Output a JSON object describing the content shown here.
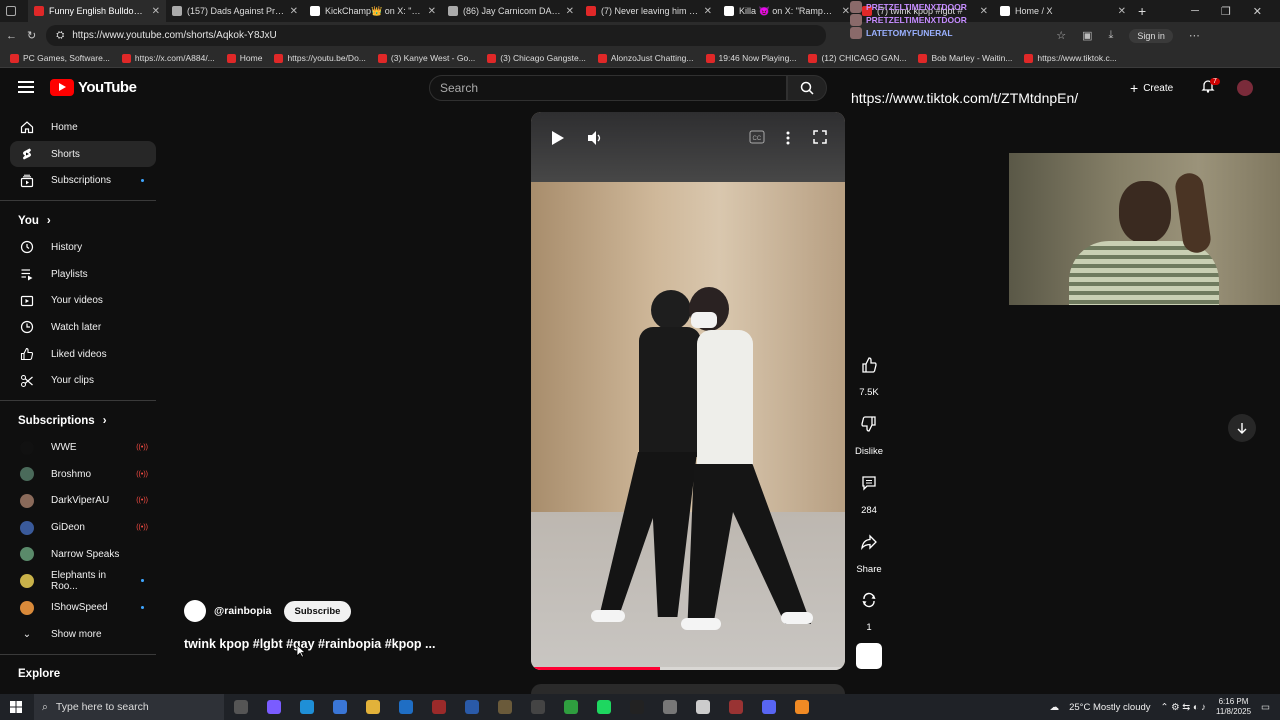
{
  "tabs": [
    {
      "title": "Funny English Bulldogs at H",
      "color": "#e02828",
      "active": true
    },
    {
      "title": "(157) Dads Against Predato",
      "color": "#aaaaaa",
      "active": false
    },
    {
      "title": "KickChamp👑 on X: \"Adin I",
      "color": "#ffffff",
      "active": false
    },
    {
      "title": "(86) Jay Carnicom DAP Con",
      "color": "#aaaaaa",
      "active": false
    },
    {
      "title": "(7) Never leaving him agai",
      "color": "#e02828",
      "active": false
    },
    {
      "title": "Killa 😈 on X: \"Rampage Jc",
      "color": "#ffffff",
      "active": false
    },
    {
      "title": "(7) twink kpop #lgbt #",
      "color": "#e02828",
      "active": false
    },
    {
      "title": "Home / X",
      "color": "#ffffff",
      "active": false
    }
  ],
  "address": {
    "url": "https://www.youtube.com/shorts/Aqkok-Y8JxU",
    "signin": "Sign in"
  },
  "bookmarks": [
    "PC Games, Software...",
    "https://x.com/A884/...",
    "Home",
    "https://youtu.be/Do...",
    "(3) Kanye West - Go...",
    "(3) Chicago Gangste...",
    "AlonzoJust Chatting...",
    "19:46 Now Playing...",
    "(12) CHICAGO GAN...",
    "Bob Marley - Waitin...",
    "https://www.tiktok.c..."
  ],
  "header": {
    "logo": "YouTube",
    "search_placeholder": "Search",
    "create": "Create",
    "notif_count": "7"
  },
  "sidebar": {
    "main": [
      {
        "label": "Home",
        "icon": "home-icon"
      },
      {
        "label": "Shorts",
        "icon": "shorts-icon",
        "active": true
      },
      {
        "label": "Subscriptions",
        "icon": "subscriptions-icon",
        "dot": true
      }
    ],
    "you_heading": "You",
    "you": [
      {
        "label": "History",
        "icon": "history-icon"
      },
      {
        "label": "Playlists",
        "icon": "playlists-icon"
      },
      {
        "label": "Your videos",
        "icon": "your-videos-icon"
      },
      {
        "label": "Watch later",
        "icon": "watch-later-icon"
      },
      {
        "label": "Liked videos",
        "icon": "liked-videos-icon"
      },
      {
        "label": "Your clips",
        "icon": "clips-icon"
      }
    ],
    "subs_heading": "Subscriptions",
    "subs": [
      {
        "label": "WWE",
        "color": "#111111",
        "status": "live"
      },
      {
        "label": "Broshmo",
        "color": "#4a6a5a",
        "status": "live"
      },
      {
        "label": "DarkViperAU",
        "color": "#8a6a5a",
        "status": "live"
      },
      {
        "label": "GiDeon",
        "color": "#3a5a9a",
        "status": "live"
      },
      {
        "label": "Narrow Speaks",
        "color": "#5a8a6a",
        "status": ""
      },
      {
        "label": "Elephants in Roo...",
        "color": "#c9b24a",
        "status": "dot"
      },
      {
        "label": "IShowSpeed",
        "color": "#d98a3a",
        "status": "dot"
      }
    ],
    "show_more": "Show more",
    "explore": "Explore"
  },
  "short": {
    "channel": "@rainbopia",
    "subscribe": "Subscribe",
    "title": "twink kpop #lgbt #gay #rainbopia #kpop ...",
    "progress": 0.41,
    "likes": "7.5K",
    "dislike": "Dislike",
    "comments": "284",
    "share": "Share",
    "remix": "1"
  },
  "stream": {
    "chat": [
      {
        "user": "PRETZELTIMENXTDOOR",
        "color": "#c58cff"
      },
      {
        "user": "PRETZELTIMENXTDOOR",
        "color": "#c58cff"
      },
      {
        "user": "LATETOMYFUNERAL",
        "color": "#9ab0ff"
      }
    ],
    "url": "https://www.tiktok.com/t/ZTMtdnpEn/"
  },
  "taskbar": {
    "search": "Type here to search",
    "weather": "25°C  Mostly cloudy",
    "time": "6:16 PM",
    "date": "11/8/2025"
  }
}
